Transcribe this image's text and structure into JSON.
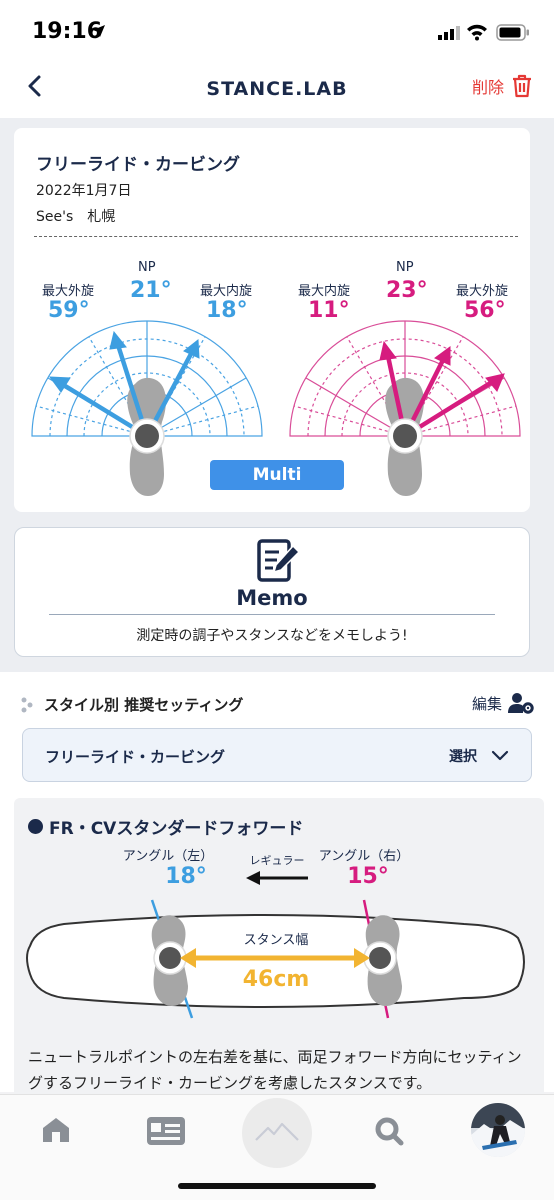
{
  "status_bar": {
    "time": "19:16"
  },
  "header": {
    "title": "STANCE.LAB",
    "delete_label": "削除"
  },
  "stance": {
    "title": "フリーライド・カービング",
    "date": "2022年1月7日",
    "place": "See's　札幌",
    "left": {
      "max_external_label": "最大外旋",
      "max_external_value": "59°",
      "np_label": "NP",
      "np_value": "21°",
      "max_internal_label": "最大内旋",
      "max_internal_value": "18°"
    },
    "right": {
      "max_internal_label": "最大内旋",
      "max_internal_value": "11°",
      "np_label": "NP",
      "np_value": "23°",
      "max_external_label": "最大外旋",
      "max_external_value": "56°"
    },
    "mode_button": "Multi"
  },
  "memo": {
    "title": "Memo",
    "prompt": "測定時の調子やスタンスなどをメモしよう!"
  },
  "style_section": {
    "title": "スタイル別 推奨セッティング",
    "edit_label": "編集",
    "selected_style": "フリーライド・カービング",
    "select_label": "選択"
  },
  "recommendation": {
    "title": "FR・CVスタンダードフォワード",
    "left_angle_label": "アングル（左）",
    "left_angle_value": "18°",
    "direction_label": "レギュラー",
    "right_angle_label": "アングル（右）",
    "right_angle_value": "15°",
    "width_label": "スタンス幅",
    "width_value": "46cm",
    "description": "ニュートラルポイントの左右差を基に、両足フォワード方向にセッティングするフリーライド・カービングを考慮したスタンスです。"
  },
  "tab_bar": {
    "items": [
      {
        "name": "home",
        "icon": "home-icon"
      },
      {
        "name": "card",
        "icon": "card-icon"
      },
      {
        "name": "measure",
        "icon": "mountain-icon"
      },
      {
        "name": "search",
        "icon": "search-icon"
      },
      {
        "name": "profile",
        "icon": "avatar"
      }
    ]
  },
  "colors": {
    "left_blue": "#3d9ee0",
    "right_pink": "#d61c7f",
    "accent_yellow": "#f2b431",
    "navy": "#1b2a4a",
    "delete_red": "#e53935",
    "multi_button": "#3f91e8"
  }
}
